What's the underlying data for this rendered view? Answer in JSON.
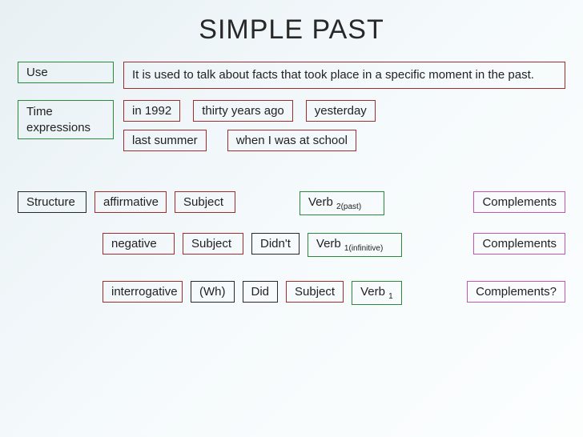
{
  "title": "SIMPLE PAST",
  "use": {
    "label": "Use",
    "description": "It is used to talk about facts that took place in a specific moment in the past."
  },
  "time": {
    "label": "Time expressions",
    "items": [
      "in 1992",
      "thirty years ago",
      "yesterday",
      "last summer",
      "when I was at school"
    ]
  },
  "structure": {
    "label": "Structure",
    "affirmative": {
      "label": "affirmative",
      "subject": "Subject",
      "verb": "Verb ",
      "verb_sub": "2(past)",
      "complements": "Complements"
    },
    "negative": {
      "label": "negative",
      "subject": "Subject",
      "helper": "Didn't",
      "verb": "Verb ",
      "verb_sub": "1(infinitive)",
      "complements": "Complements"
    },
    "interrogative": {
      "label": "interrogative",
      "wh": "(Wh)",
      "helper": "Did",
      "subject": "Subject",
      "verb": "Verb ",
      "verb_sub": "1",
      "complements": "Complements?"
    }
  }
}
